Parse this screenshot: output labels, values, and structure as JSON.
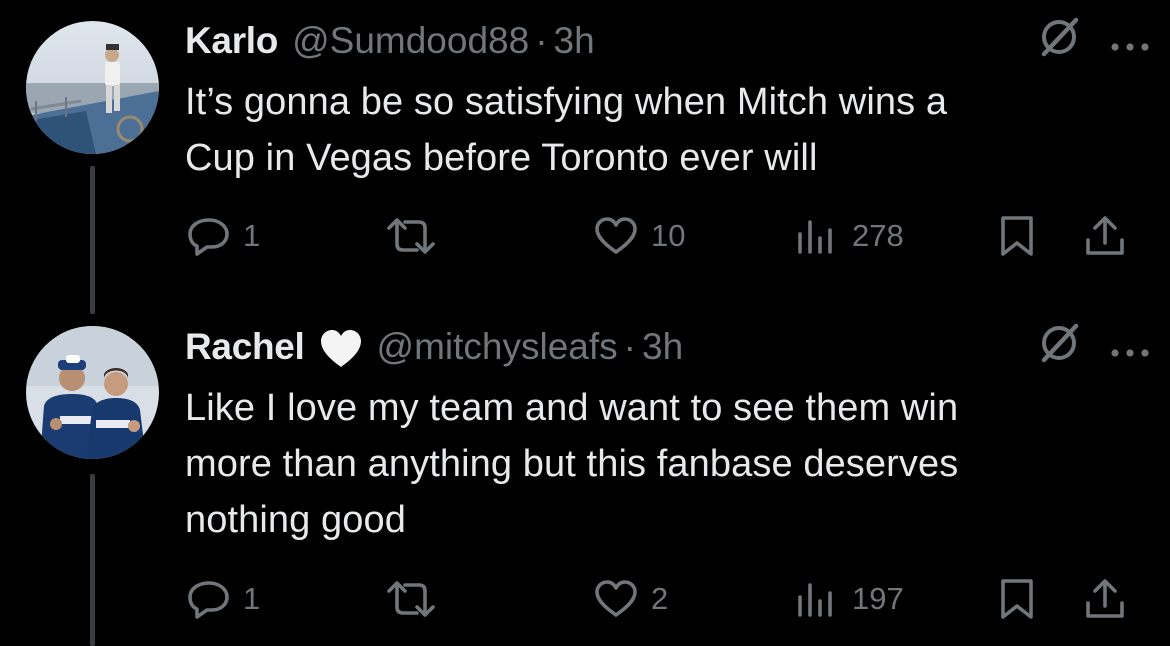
{
  "colors": {
    "background": "#000000",
    "text_primary": "#e7e9ea",
    "text_secondary": "#71767b",
    "thread_line": "#3a3d41"
  },
  "tweets": [
    {
      "name": "Karlo",
      "handle": "@Sumdood88",
      "separator": "·",
      "time": "3h",
      "text_lines": [
        "It’s gonna be so satisfying when Mitch wins a",
        "Cup in Vegas before Toronto ever will"
      ],
      "replies": "1",
      "reposts": "",
      "likes": "10",
      "views": "278",
      "avatar_icon": "person-on-boat-photo-avatar"
    },
    {
      "name": "Rachel",
      "name_emoji": "white-heart-icon",
      "handle": "@mitchysleafs",
      "separator": "·",
      "time": "3h",
      "text_lines": [
        "Like I love my team and want to see them win",
        "more than anything but this fanbase deserves",
        "nothing good"
      ],
      "replies": "1",
      "reposts": "",
      "likes": "2",
      "views": "197",
      "avatar_icon": "two-players-photo-avatar"
    }
  ]
}
